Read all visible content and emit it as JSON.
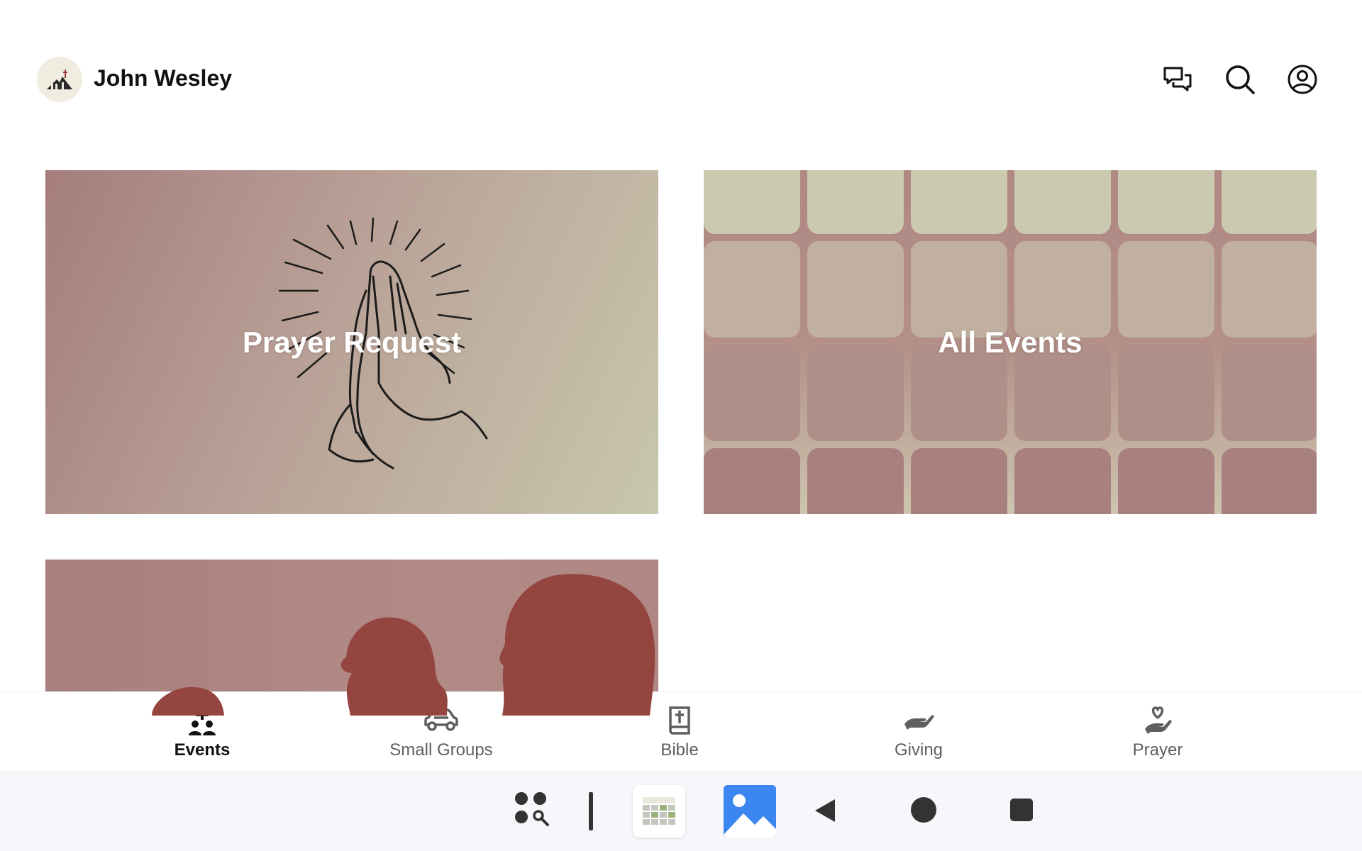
{
  "header": {
    "title": "John Wesley",
    "logo_icon": "church-logo",
    "icons": [
      "chat-icon",
      "search-icon",
      "account-icon"
    ]
  },
  "cards": {
    "prayer": {
      "label": "Prayer Request",
      "image": "praying-hands"
    },
    "events": {
      "label": "All Events",
      "image": "calendar-grid"
    },
    "third": {
      "label": "",
      "image": "people-silhouettes"
    }
  },
  "nav": {
    "items": [
      {
        "label": "Events",
        "icon": "events-icon",
        "active": true
      },
      {
        "label": "Small Groups",
        "icon": "car-icon",
        "active": false
      },
      {
        "label": "Bible",
        "icon": "bible-icon",
        "active": false
      },
      {
        "label": "Giving",
        "icon": "giving-hand-icon",
        "active": false
      },
      {
        "label": "Prayer",
        "icon": "prayer-heart-icon",
        "active": false
      }
    ]
  },
  "system_bar": {
    "icons": [
      "app-search-icon",
      "calendar-app-icon",
      "photos-app-icon",
      "back-icon",
      "home-icon",
      "recents-icon"
    ]
  },
  "colors": {
    "card_rose": "#a57d7d",
    "card_sage": "#c8c7ad",
    "accent_active": "#111111",
    "inactive": "#5f5f5f"
  }
}
